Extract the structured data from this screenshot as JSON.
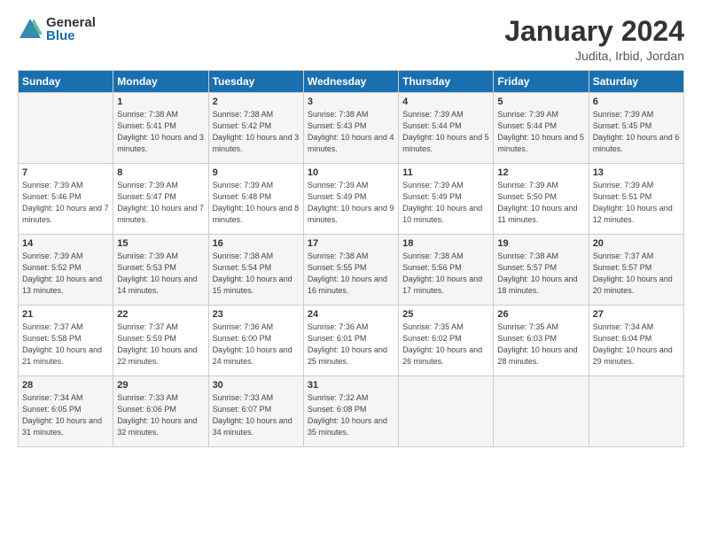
{
  "logo": {
    "general": "General",
    "blue": "Blue"
  },
  "title": "January 2024",
  "subtitle": "Judita, Irbid, Jordan",
  "days_header": [
    "Sunday",
    "Monday",
    "Tuesday",
    "Wednesday",
    "Thursday",
    "Friday",
    "Saturday"
  ],
  "weeks": [
    [
      {
        "num": "",
        "info": ""
      },
      {
        "num": "1",
        "info": "Sunrise: 7:38 AM\nSunset: 5:41 PM\nDaylight: 10 hours\nand 3 minutes."
      },
      {
        "num": "2",
        "info": "Sunrise: 7:38 AM\nSunset: 5:42 PM\nDaylight: 10 hours\nand 3 minutes."
      },
      {
        "num": "3",
        "info": "Sunrise: 7:38 AM\nSunset: 5:43 PM\nDaylight: 10 hours\nand 4 minutes."
      },
      {
        "num": "4",
        "info": "Sunrise: 7:39 AM\nSunset: 5:44 PM\nDaylight: 10 hours\nand 5 minutes."
      },
      {
        "num": "5",
        "info": "Sunrise: 7:39 AM\nSunset: 5:44 PM\nDaylight: 10 hours\nand 5 minutes."
      },
      {
        "num": "6",
        "info": "Sunrise: 7:39 AM\nSunset: 5:45 PM\nDaylight: 10 hours\nand 6 minutes."
      }
    ],
    [
      {
        "num": "7",
        "info": "Sunrise: 7:39 AM\nSunset: 5:46 PM\nDaylight: 10 hours\nand 7 minutes."
      },
      {
        "num": "8",
        "info": "Sunrise: 7:39 AM\nSunset: 5:47 PM\nDaylight: 10 hours\nand 7 minutes."
      },
      {
        "num": "9",
        "info": "Sunrise: 7:39 AM\nSunset: 5:48 PM\nDaylight: 10 hours\nand 8 minutes."
      },
      {
        "num": "10",
        "info": "Sunrise: 7:39 AM\nSunset: 5:49 PM\nDaylight: 10 hours\nand 9 minutes."
      },
      {
        "num": "11",
        "info": "Sunrise: 7:39 AM\nSunset: 5:49 PM\nDaylight: 10 hours\nand 10 minutes."
      },
      {
        "num": "12",
        "info": "Sunrise: 7:39 AM\nSunset: 5:50 PM\nDaylight: 10 hours\nand 11 minutes."
      },
      {
        "num": "13",
        "info": "Sunrise: 7:39 AM\nSunset: 5:51 PM\nDaylight: 10 hours\nand 12 minutes."
      }
    ],
    [
      {
        "num": "14",
        "info": "Sunrise: 7:39 AM\nSunset: 5:52 PM\nDaylight: 10 hours\nand 13 minutes."
      },
      {
        "num": "15",
        "info": "Sunrise: 7:39 AM\nSunset: 5:53 PM\nDaylight: 10 hours\nand 14 minutes."
      },
      {
        "num": "16",
        "info": "Sunrise: 7:38 AM\nSunset: 5:54 PM\nDaylight: 10 hours\nand 15 minutes."
      },
      {
        "num": "17",
        "info": "Sunrise: 7:38 AM\nSunset: 5:55 PM\nDaylight: 10 hours\nand 16 minutes."
      },
      {
        "num": "18",
        "info": "Sunrise: 7:38 AM\nSunset: 5:56 PM\nDaylight: 10 hours\nand 17 minutes."
      },
      {
        "num": "19",
        "info": "Sunrise: 7:38 AM\nSunset: 5:57 PM\nDaylight: 10 hours\nand 18 minutes."
      },
      {
        "num": "20",
        "info": "Sunrise: 7:37 AM\nSunset: 5:57 PM\nDaylight: 10 hours\nand 20 minutes."
      }
    ],
    [
      {
        "num": "21",
        "info": "Sunrise: 7:37 AM\nSunset: 5:58 PM\nDaylight: 10 hours\nand 21 minutes."
      },
      {
        "num": "22",
        "info": "Sunrise: 7:37 AM\nSunset: 5:59 PM\nDaylight: 10 hours\nand 22 minutes."
      },
      {
        "num": "23",
        "info": "Sunrise: 7:36 AM\nSunset: 6:00 PM\nDaylight: 10 hours\nand 24 minutes."
      },
      {
        "num": "24",
        "info": "Sunrise: 7:36 AM\nSunset: 6:01 PM\nDaylight: 10 hours\nand 25 minutes."
      },
      {
        "num": "25",
        "info": "Sunrise: 7:35 AM\nSunset: 6:02 PM\nDaylight: 10 hours\nand 26 minutes."
      },
      {
        "num": "26",
        "info": "Sunrise: 7:35 AM\nSunset: 6:03 PM\nDaylight: 10 hours\nand 28 minutes."
      },
      {
        "num": "27",
        "info": "Sunrise: 7:34 AM\nSunset: 6:04 PM\nDaylight: 10 hours\nand 29 minutes."
      }
    ],
    [
      {
        "num": "28",
        "info": "Sunrise: 7:34 AM\nSunset: 6:05 PM\nDaylight: 10 hours\nand 31 minutes."
      },
      {
        "num": "29",
        "info": "Sunrise: 7:33 AM\nSunset: 6:06 PM\nDaylight: 10 hours\nand 32 minutes."
      },
      {
        "num": "30",
        "info": "Sunrise: 7:33 AM\nSunset: 6:07 PM\nDaylight: 10 hours\nand 34 minutes."
      },
      {
        "num": "31",
        "info": "Sunrise: 7:32 AM\nSunset: 6:08 PM\nDaylight: 10 hours\nand 35 minutes."
      },
      {
        "num": "",
        "info": ""
      },
      {
        "num": "",
        "info": ""
      },
      {
        "num": "",
        "info": ""
      }
    ]
  ]
}
